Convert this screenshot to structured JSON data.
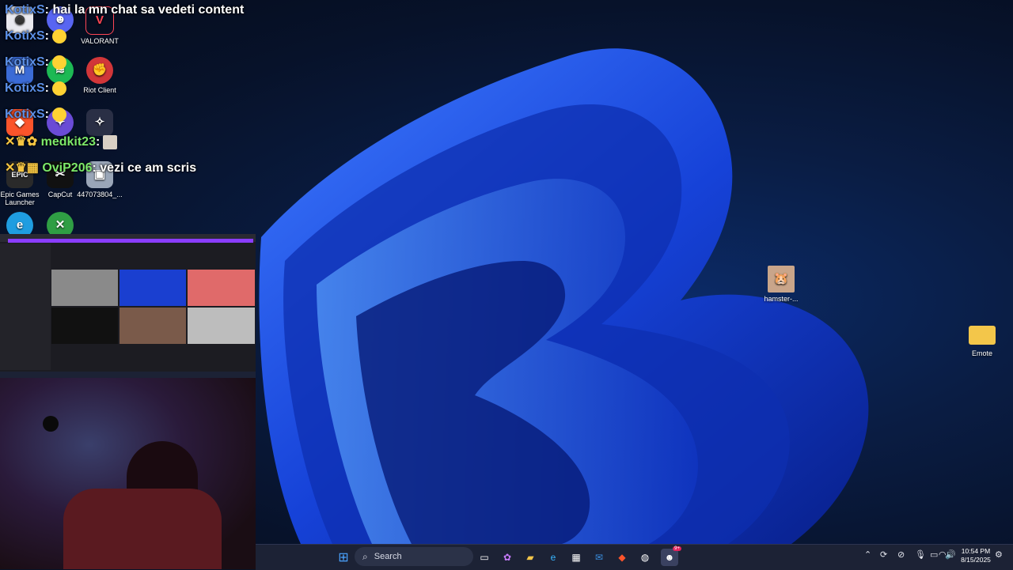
{
  "desktop_icons": [
    {
      "label": "",
      "icon": "app-icon",
      "color": "#e9e9ef"
    },
    {
      "label": "",
      "icon": "discord-icon",
      "color": "#5865f2"
    },
    {
      "label": "VALORANT",
      "icon": "valorant-icon",
      "color": "#ff4655"
    },
    {
      "label": "",
      "icon": "app-icon",
      "color": "#3b6bd6"
    },
    {
      "label": "",
      "icon": "spotify-icon",
      "color": "#1db954"
    },
    {
      "label": "Riot Client",
      "icon": "riot-client-icon",
      "color": "#d13639"
    },
    {
      "label": "",
      "icon": "brave-icon",
      "color": "#fb542b"
    },
    {
      "label": "",
      "icon": "app-icon",
      "color": "#6a4bd6"
    },
    {
      "label": "",
      "icon": "app-icon",
      "color": "#2a2f45"
    },
    {
      "label": "Epic Games Launcher",
      "icon": "epic-games-icon",
      "color": "#2a2a2a"
    },
    {
      "label": "CapCut",
      "icon": "capcut-icon",
      "color": "#111111"
    },
    {
      "label": "447073804_...",
      "icon": "image-file-icon",
      "color": "#9aa6b8"
    },
    {
      "label": "",
      "icon": "edge-icon",
      "color": "#1f9de0"
    },
    {
      "label": "",
      "icon": "xbox-icon",
      "color": "#2f9e44"
    },
    {
      "label": "hamster-...",
      "icon": "image-file-icon",
      "color": "#c9a58a"
    },
    {
      "label": "Emote",
      "icon": "folder-icon",
      "color": "#f3c64a"
    }
  ],
  "chat": [
    {
      "user": "KotixS",
      "text": "hai la mn chat sa vedeti content"
    },
    {
      "user": "KotixS",
      "text": ""
    },
    {
      "user": "KotixS",
      "text": ""
    },
    {
      "user": "KotixS",
      "text": ""
    },
    {
      "user": "KotixS",
      "text": ""
    },
    {
      "user": "medkit23",
      "text": ""
    },
    {
      "user": "OviP206",
      "text": "vezi ce am scris"
    }
  ],
  "taskbar": {
    "search_placeholder": "Search",
    "time": "10:54 PM",
    "date": "8/15/2025",
    "discord_badge": "9+"
  },
  "colors": {
    "accent": "#1b5cff",
    "taskbar": "#1c2235",
    "chat_user": "#5b8fe6",
    "chat_user_alt": "#7ce86a"
  }
}
